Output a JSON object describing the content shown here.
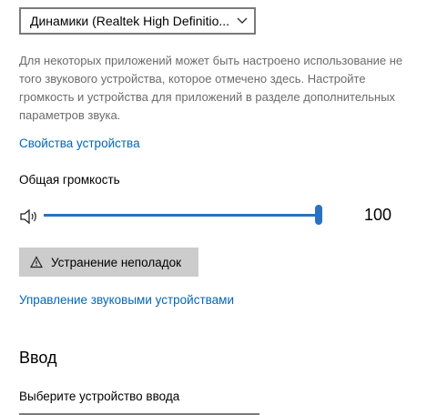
{
  "output_device": {
    "selected": "Динамики (Realtek High Definitio...",
    "chevron_icon": "chevron-down-icon"
  },
  "description": "Для некоторых приложений может быть настроено использование не того звукового устройства, которое отмечено здесь. Настройте громкость и устройства для приложений в разделе дополнительных параметров звука.",
  "device_properties_link": "Свойства устройства",
  "master_volume": {
    "label": "Общая громкость",
    "icon": "speaker-icon",
    "value": 100,
    "value_text": "100",
    "accent_color": "#2a72c1"
  },
  "troubleshoot_button": {
    "label": "Устранение неполадок",
    "icon": "warning-icon"
  },
  "manage_devices_link": "Управление звуковыми устройствами",
  "input_section": {
    "title": "Ввод",
    "select_label": "Выберите устройство ввода"
  },
  "colors": {
    "link": "#0067b8",
    "button_bg": "#cccccc",
    "secondary_text": "#6b6b6b"
  }
}
